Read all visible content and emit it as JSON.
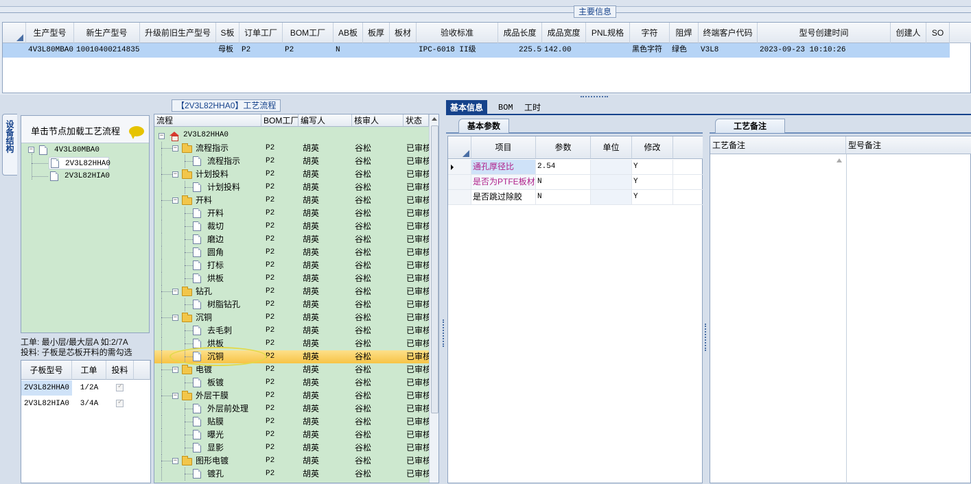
{
  "main_info": {
    "caption": "主要信息",
    "columns": [
      "生产型号",
      "新生产型号",
      "升级前旧生产型号",
      "S板",
      "订单工厂",
      "BOM工厂",
      "AB板",
      "板厚",
      "板材",
      "验收标准",
      "成品长度",
      "成品宽度",
      "PNL规格",
      "字符",
      "阻焊",
      "终端客户代码",
      "型号创建时间",
      "创建人",
      "SO"
    ],
    "row": [
      "4V3L80MBA0",
      "10010400214835",
      "",
      "母板",
      "P2",
      "P2",
      "N",
      "",
      "",
      "IPC-6018 II级",
      "225.50",
      "142.00",
      "",
      "黑色字符",
      "绿色",
      "V3L8",
      "2023-09-23 10:10:26",
      "",
      ""
    ]
  },
  "side_tab": {
    "label": "设备结构"
  },
  "load_panel": {
    "title": "单击节点加载工艺流程",
    "tree": [
      {
        "label": "4V3L80MBA0"
      },
      {
        "label": "2V3L82HHA0"
      },
      {
        "label": "2V3L82HIA0"
      }
    ]
  },
  "note": {
    "line1": "工单: 最小层/最大层A 如:2/7A",
    "line2": "投料: 子板是芯板开料的需勾选"
  },
  "sub_grid": {
    "columns": [
      "子板型号",
      "工单",
      "投料"
    ],
    "rows": [
      {
        "model": "2V3L82HHA0",
        "order": "1/2A"
      },
      {
        "model": "2V3L82HIA0",
        "order": "3/4A"
      }
    ]
  },
  "process": {
    "caption": "【2V3L82HHA0】工艺流程",
    "columns": [
      "流程",
      "BOM工厂",
      "编写人",
      "核审人",
      "状态"
    ],
    "root": "2V3L82HHA0",
    "rows": [
      {
        "name": "流程指示",
        "level": 1,
        "factory": "P2",
        "writer": "胡英",
        "reviewer": "谷松",
        "status": "已审核"
      },
      {
        "name": "流程指示",
        "level": 2,
        "factory": "P2",
        "writer": "胡英",
        "reviewer": "谷松",
        "status": "已审核"
      },
      {
        "name": "计划投料",
        "level": 1,
        "factory": "P2",
        "writer": "胡英",
        "reviewer": "谷松",
        "status": "已审核"
      },
      {
        "name": "计划投料",
        "level": 2,
        "factory": "P2",
        "writer": "胡英",
        "reviewer": "谷松",
        "status": "已审核"
      },
      {
        "name": "开料",
        "level": 1,
        "factory": "P2",
        "writer": "胡英",
        "reviewer": "谷松",
        "status": "已审核"
      },
      {
        "name": "开料",
        "level": 2,
        "factory": "P2",
        "writer": "胡英",
        "reviewer": "谷松",
        "status": "已审核"
      },
      {
        "name": "裁切",
        "level": 2,
        "factory": "P2",
        "writer": "胡英",
        "reviewer": "谷松",
        "status": "已审核"
      },
      {
        "name": "磨边",
        "level": 2,
        "factory": "P2",
        "writer": "胡英",
        "reviewer": "谷松",
        "status": "已审核"
      },
      {
        "name": "圆角",
        "level": 2,
        "factory": "P2",
        "writer": "胡英",
        "reviewer": "谷松",
        "status": "已审核"
      },
      {
        "name": "打标",
        "level": 2,
        "factory": "P2",
        "writer": "胡英",
        "reviewer": "谷松",
        "status": "已审核"
      },
      {
        "name": "烘板",
        "level": 2,
        "factory": "P2",
        "writer": "胡英",
        "reviewer": "谷松",
        "status": "已审核"
      },
      {
        "name": "钻孔",
        "level": 1,
        "factory": "P2",
        "writer": "胡英",
        "reviewer": "谷松",
        "status": "已审核"
      },
      {
        "name": "树脂钻孔",
        "level": 2,
        "factory": "P2",
        "writer": "胡英",
        "reviewer": "谷松",
        "status": "已审核"
      },
      {
        "name": "沉铜",
        "level": 1,
        "factory": "P2",
        "writer": "胡英",
        "reviewer": "谷松",
        "status": "已审核"
      },
      {
        "name": "去毛刺",
        "level": 2,
        "factory": "P2",
        "writer": "胡英",
        "reviewer": "谷松",
        "status": "已审核"
      },
      {
        "name": "烘板",
        "level": 2,
        "factory": "P2",
        "writer": "胡英",
        "reviewer": "谷松",
        "status": "已审核"
      },
      {
        "name": "沉铜",
        "level": 2,
        "factory": "P2",
        "writer": "胡英",
        "reviewer": "谷松",
        "status": "已审核",
        "selected": true
      },
      {
        "name": "电镀",
        "level": 1,
        "factory": "P2",
        "writer": "胡英",
        "reviewer": "谷松",
        "status": "已审核"
      },
      {
        "name": "板镀",
        "level": 2,
        "factory": "P2",
        "writer": "胡英",
        "reviewer": "谷松",
        "status": "已审核"
      },
      {
        "name": "外层干膜",
        "level": 1,
        "factory": "P2",
        "writer": "胡英",
        "reviewer": "谷松",
        "status": "已审核"
      },
      {
        "name": "外层前处理",
        "level": 2,
        "factory": "P2",
        "writer": "胡英",
        "reviewer": "谷松",
        "status": "已审核"
      },
      {
        "name": "贴膜",
        "level": 2,
        "factory": "P2",
        "writer": "胡英",
        "reviewer": "谷松",
        "status": "已审核"
      },
      {
        "name": "曝光",
        "level": 2,
        "factory": "P2",
        "writer": "胡英",
        "reviewer": "谷松",
        "status": "已审核"
      },
      {
        "name": "显影",
        "level": 2,
        "factory": "P2",
        "writer": "胡英",
        "reviewer": "谷松",
        "status": "已审核"
      },
      {
        "name": "图形电镀",
        "level": 1,
        "factory": "P2",
        "writer": "胡英",
        "reviewer": "谷松",
        "status": "已审核"
      },
      {
        "name": "镀孔",
        "level": 2,
        "factory": "P2",
        "writer": "胡英",
        "reviewer": "谷松",
        "status": "已审核"
      }
    ]
  },
  "tabs": [
    "基本信息",
    "BOM",
    "工时"
  ],
  "basic_params": {
    "subtab": "基本参数",
    "columns": [
      "项目",
      "参数",
      "单位",
      "修改"
    ],
    "rows": [
      {
        "item": "通孔厚径比",
        "param": "2.54",
        "unit": "",
        "edit": "Y",
        "color": "#b0208a"
      },
      {
        "item": "是否为PTFE板材",
        "param": "N",
        "unit": "",
        "edit": "Y",
        "color": "#b0208a"
      },
      {
        "item": "是否跳过除胶",
        "param": "N",
        "unit": "",
        "edit": "Y",
        "color": "#000000"
      }
    ]
  },
  "remarks": {
    "subtab": "工艺备注",
    "columns": [
      "工艺备注",
      "型号备注"
    ]
  }
}
